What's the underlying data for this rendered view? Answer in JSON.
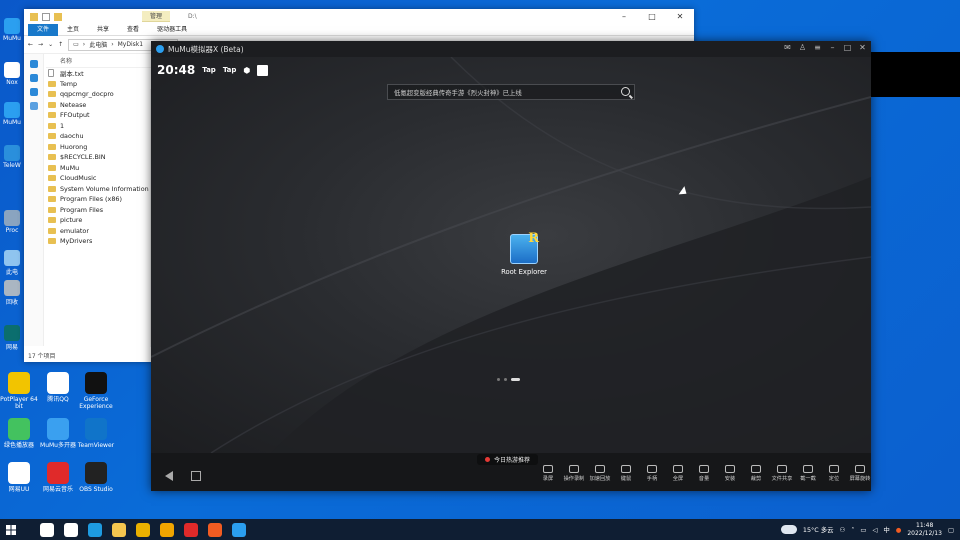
{
  "desktop": {
    "left_icons": [
      {
        "label": "MuMu",
        "color": "#2b9ff0"
      },
      {
        "label": "Nox",
        "color": "#ffffff"
      },
      {
        "label": "MuMu",
        "color": "#2b9ff0"
      },
      {
        "label": "TeleW",
        "color": "#2a8fdc"
      },
      {
        "label": "Proc",
        "color": "#8aa4c0"
      },
      {
        "label": "此电",
        "color": "#8fc4ef"
      },
      {
        "label": "回收",
        "color": "#aab6c2"
      },
      {
        "label": "网易",
        "color": "#0b6e6e"
      }
    ],
    "grid_icons": [
      {
        "label": "PotPlayer 64 bit",
        "color": "#f2c400",
        "icon": "potplayer-icon"
      },
      {
        "label": "腾讯QQ",
        "color": "#ffffff",
        "icon": "qq-icon"
      },
      {
        "label": "GeForce Experience",
        "color": "#111111",
        "icon": "geforce-icon"
      },
      {
        "label": "绿色播放器",
        "color": "#43c25f",
        "icon": "player-icon"
      },
      {
        "label": "MuMu多开器",
        "color": "#3aa0f0",
        "icon": "mumu-multi-icon"
      },
      {
        "label": "TeamViewer",
        "color": "#1074c9",
        "icon": "teamviewer-icon"
      },
      {
        "label": "网易UU",
        "color": "#ffffff",
        "icon": "uu-icon"
      },
      {
        "label": "网易云音乐",
        "color": "#e02a2a",
        "icon": "cloudmusic-icon"
      },
      {
        "label": "OBS Studio",
        "color": "#222222",
        "icon": "obs-icon"
      }
    ]
  },
  "explorer": {
    "title_path": "D:\\",
    "context_tab": "管理",
    "ribbon_tabs": [
      "文件",
      "主页",
      "共享",
      "查看",
      "驱动器工具"
    ],
    "breadcrumb": [
      "此电脑",
      "MyDisk1"
    ],
    "column_header": "名称",
    "items": [
      {
        "name": "副本.txt",
        "kind": "file"
      },
      {
        "name": "Temp",
        "kind": "folder"
      },
      {
        "name": "qqpcmgr_docpro",
        "kind": "folder"
      },
      {
        "name": "Netease",
        "kind": "folder"
      },
      {
        "name": "FFOutput",
        "kind": "folder"
      },
      {
        "name": "1",
        "kind": "folder"
      },
      {
        "name": "daochu",
        "kind": "folder"
      },
      {
        "name": "Huorong",
        "kind": "folder"
      },
      {
        "name": "$RECYCLE.BIN",
        "kind": "folder"
      },
      {
        "name": "MuMu",
        "kind": "folder"
      },
      {
        "name": "CloudMusic",
        "kind": "folder"
      },
      {
        "name": "System Volume Information",
        "kind": "folder"
      },
      {
        "name": "Program Files (x86)",
        "kind": "folder"
      },
      {
        "name": "Program Files",
        "kind": "folder"
      },
      {
        "name": "picture",
        "kind": "folder"
      },
      {
        "name": "emulator",
        "kind": "folder"
      },
      {
        "name": "MyDrivers",
        "kind": "folder"
      }
    ],
    "status": "17 个项目"
  },
  "mumu": {
    "title": "MuMu模拟器X (Beta)",
    "clock": "20:48",
    "status_icons": [
      "Tap",
      "Tap"
    ],
    "search_placeholder": "低氪超变版经典传奇手游《烈火封神》已上线",
    "app_label": "Root Explorer",
    "hot_label": "今日热游推荐",
    "tools": [
      "录屏",
      "操作录制",
      "加速回放",
      "键鼠",
      "手柄",
      "全屏",
      "音量",
      "安装",
      "裁剪",
      "文件共享",
      "截一截",
      "定位",
      "屏幕旋转"
    ]
  },
  "taskbar": {
    "weather": "15°C 多云",
    "ime": "中",
    "time": "11:48",
    "date": "2022/12/13",
    "pinned": [
      {
        "icon": "search-icon",
        "color": "#ffffff"
      },
      {
        "icon": "taskview-icon",
        "color": "#ffffff"
      },
      {
        "icon": "edge-icon",
        "color": "#1e9be0"
      },
      {
        "icon": "explorer-icon",
        "color": "#f4c64f"
      },
      {
        "icon": "chrome-icon",
        "color": "#e9b100"
      },
      {
        "icon": "store-icon",
        "color": "#f0a500"
      },
      {
        "icon": "netease-icon",
        "color": "#e02a2a"
      },
      {
        "icon": "app-red-icon",
        "color": "#f25c22"
      },
      {
        "icon": "mumu-icon",
        "color": "#2b9ff0"
      }
    ]
  }
}
